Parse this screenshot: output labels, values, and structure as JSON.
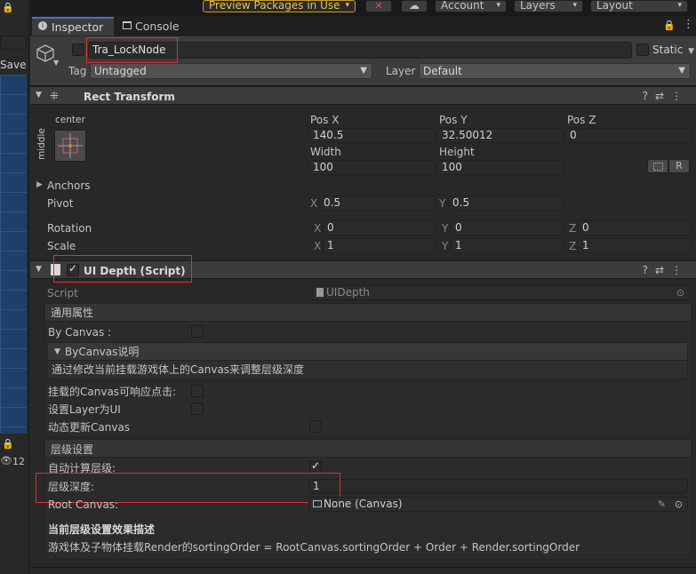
{
  "toolbar": {
    "preview_packages": "Preview Packages in Use",
    "account": "Account",
    "layers": "Layers",
    "layout": "Layout"
  },
  "tabs": {
    "inspector": "Inspector",
    "console": "Console"
  },
  "left_panel": {
    "save": "Save",
    "visibility_count": "12"
  },
  "gameobject": {
    "name": "Tra_LockNode",
    "static_label": "Static",
    "tag_label": "Tag",
    "tag_value": "Untagged",
    "layer_label": "Layer",
    "layer_value": "Default"
  },
  "rect_transform": {
    "title": "Rect Transform",
    "anchor_h": "center",
    "anchor_v": "middle",
    "pos_x_label": "Pos X",
    "pos_y_label": "Pos Y",
    "pos_z_label": "Pos Z",
    "pos_x": "140.5",
    "pos_y": "32.50012",
    "pos_z": "0",
    "width_label": "Width",
    "height_label": "Height",
    "width": "100",
    "height": "100",
    "r_button": "R",
    "anchors_label": "Anchors",
    "pivot_label": "Pivot",
    "pivot_x": "0.5",
    "pivot_y": "0.5",
    "rotation_label": "Rotation",
    "rot_x": "0",
    "rot_y": "0",
    "rot_z": "0",
    "scale_label": "Scale",
    "scale_x": "1",
    "scale_y": "1",
    "scale_z": "1",
    "x": "X",
    "y": "Y",
    "z": "Z"
  },
  "ui_depth": {
    "title": "UI Depth (Script)",
    "script_label": "Script",
    "script_value": "UIDepth",
    "general_group": "通用属性",
    "by_canvas_label": "By Canvas :",
    "by_canvas_help_title": "ByCanvas说明",
    "by_canvas_help_text": "通过修改当前挂载游戏体上的Canvas来调整层级深度",
    "canvas_click_label": "挂载的Canvas可响应点击:",
    "set_layer_label": "设置Layer为UI",
    "dynamic_update_label": "动态更新Canvas",
    "depth_group": "层级设置",
    "auto_calc_label": "自动计算层级:",
    "depth_label": "层级深度:",
    "depth_value": "1",
    "root_canvas_label": "Root Canvas:",
    "root_canvas_value": "None (Canvas)",
    "desc_title": "当前层级设置效果描述",
    "desc_text": "游戏体及子物体挂载Render的sortingOrder  = RootCanvas.sortingOrder + Order + Render.sortingOrder"
  },
  "colors": {
    "background": "#282828",
    "header": "#3c3c3c",
    "highlight": "#e03030",
    "scene_blue": "#1f3f6a"
  }
}
